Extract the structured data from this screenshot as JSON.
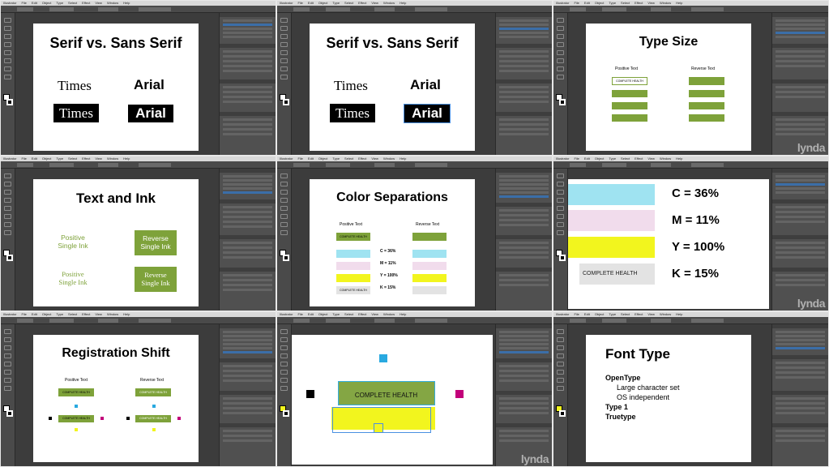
{
  "app": {
    "menu": [
      "Illustrator",
      "File",
      "Edit",
      "Object",
      "Type",
      "Select",
      "Effect",
      "View",
      "Window",
      "Help"
    ],
    "watermark": "lynda"
  },
  "slides": {
    "s1": {
      "title": "Serif vs. Sans Serif",
      "times": "Times",
      "arial": "Arial"
    },
    "s2": {
      "title": "Serif vs. Sans Serif",
      "times": "Times",
      "arial": "Arial"
    },
    "s3": {
      "title": "Type Size",
      "positive": "Positive Text",
      "reverse": "Reverse Text",
      "label": "COMPLETE HEALTH"
    },
    "s4": {
      "title": "Text and Ink",
      "pos1a": "Positive",
      "pos1b": "Single Ink",
      "rev1a": "Reverse",
      "rev1b": "Single Ink",
      "pos2a": "Positive",
      "pos2b": "Single Ink",
      "rev2a": "Reverse",
      "rev2b": "Single Ink"
    },
    "s5": {
      "title": "Color Separations",
      "positive": "Positive Text",
      "reverse": "Reverse Text",
      "label": "COMPLETE HEALTH",
      "c": "C = 36%",
      "m": "M = 11%",
      "y": "Y = 100%",
      "k": "K = 15%"
    },
    "s6": {
      "c": "C = 36%",
      "m": "M = 11%",
      "y": "Y = 100%",
      "k": "K = 15%",
      "label": "COMPLETE HEALTH"
    },
    "s7": {
      "title": "Registration Shift",
      "positive": "Positive Text",
      "reverse": "Reverse Text",
      "label": "COMPLETE HEALTH"
    },
    "s8": {
      "label": "COMPLETE HEALTH"
    },
    "s9": {
      "title": "Font Type",
      "opentype": "OpenType",
      "bullet1": "Large character set",
      "bullet2": "OS independent",
      "type1": "Type 1",
      "truetype": "Truetype"
    }
  },
  "colors": {
    "green": "#7ea23a",
    "cyan": "#9fe3f1",
    "magenta": "#f1dcec",
    "yellow": "#f2f51e",
    "khaki": "#e3e3e3"
  }
}
